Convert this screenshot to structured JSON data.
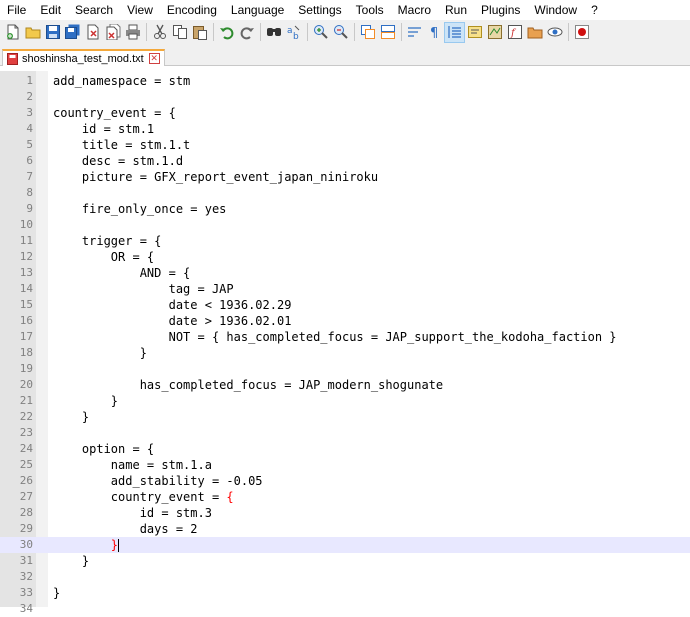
{
  "menu": [
    "File",
    "Edit",
    "Search",
    "View",
    "Encoding",
    "Language",
    "Settings",
    "Tools",
    "Macro",
    "Run",
    "Plugins",
    "Window",
    "?"
  ],
  "toolbar": {
    "icons": [
      "new-file-icon",
      "open-file-icon",
      "save-icon",
      "save-all-icon",
      "close-icon",
      "close-all-icon",
      "print-icon",
      "cut-icon",
      "copy-icon",
      "paste-icon",
      "undo-icon",
      "redo-icon",
      "find-icon",
      "replace-icon",
      "zoom-in-icon",
      "zoom-out-icon",
      "sync-vertical-icon",
      "sync-horizontal-icon",
      "word-wrap-icon",
      "show-all-chars-icon",
      "indent-guide-icon",
      "user-language-icon",
      "document-map-icon",
      "function-list-icon",
      "folder-workspace-icon",
      "monitoring-icon",
      "record-macro-icon"
    ]
  },
  "tab": {
    "filename": "shoshinsha_test_mod.txt",
    "close": "✕"
  },
  "editor": {
    "current_line": 30,
    "lines": [
      "add_namespace = stm",
      "",
      "country_event = {",
      "    id = stm.1",
      "    title = stm.1.t",
      "    desc = stm.1.d",
      "    picture = GFX_report_event_japan_niniroku",
      "",
      "    fire_only_once = yes",
      "",
      "    trigger = {",
      "        OR = {",
      "            AND = {",
      "                tag = JAP",
      "                date < 1936.02.29",
      "                date > 1936.02.01",
      "                NOT = { has_completed_focus = JAP_support_the_kodoha_faction }",
      "            }",
      "",
      "            has_completed_focus = JAP_modern_shogunate",
      "        }",
      "    }",
      "",
      "    option = {",
      "        name = stm.1.a",
      "        add_stability = -0.05",
      "        country_event = ",
      "            id = stm.3",
      "            days = 2",
      "        ",
      "    }",
      "",
      "}",
      ""
    ],
    "line_numbers": [
      "1",
      "2",
      "3",
      "4",
      "5",
      "6",
      "7",
      "8",
      "9",
      "10",
      "11",
      "12",
      "13",
      "14",
      "15",
      "16",
      "17",
      "18",
      "19",
      "20",
      "21",
      "22",
      "23",
      "24",
      "25",
      "26",
      "27",
      "28",
      "29",
      "30",
      "31",
      "32",
      "33",
      "34"
    ],
    "highlight_brace": "{",
    "highlight_brace_close": "}"
  },
  "colors": {
    "brace_match": "#ff0000",
    "current_line": "#e8e8ff",
    "tab_accent": "#f4a83a"
  }
}
